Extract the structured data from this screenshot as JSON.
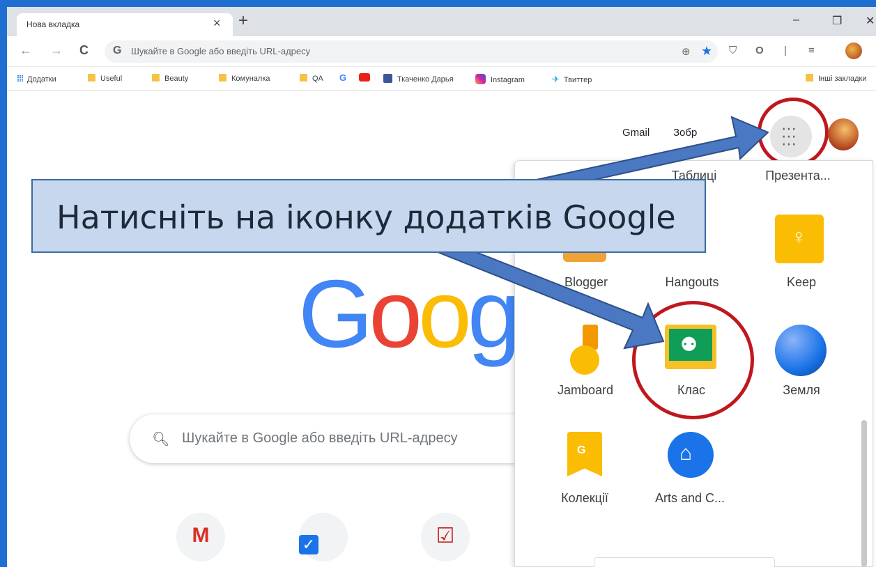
{
  "browser": {
    "tab_title": "Нова вкладка",
    "tab_close": "×",
    "new_tab": "+",
    "window_minimize": "–",
    "window_restore": "❐",
    "window_close": "✕",
    "omnibox_g": "G",
    "omnibox_placeholder": "Шукайте в Google або введіть URL-адресу",
    "back": "←",
    "forward": "→",
    "reload": "C"
  },
  "bookmarks": {
    "apps": "Додатки",
    "items": [
      "Useful",
      "Beauty",
      "Комуналка",
      "QA",
      "G",
      "Ткаченко Дарья",
      "Instagram",
      "Твиттер"
    ],
    "other": "Інші закладки"
  },
  "page": {
    "gmail": "Gmail",
    "images": "Зобр",
    "search_placeholder": "Шукайте в Google або введіть URL-адресу",
    "logo": [
      "G",
      "o",
      "o",
      "g"
    ],
    "logo_colors": [
      "#4285f4",
      "#ea4335",
      "#fbbc05",
      "#4285f4"
    ]
  },
  "launcher": {
    "top_labels": [
      "Таблиці",
      "Презента..."
    ],
    "apps": [
      "Blogger",
      "Hangouts",
      "Keep",
      "Jamboard",
      "Клас",
      "Земля",
      "Колекції",
      "Arts and C..."
    ]
  },
  "callout": {
    "text": "Натисніть на іконку додатків Google"
  },
  "colors": {
    "frame": "#1f6fd1",
    "highlight": "#c0171e",
    "arrow": "#4a78c2"
  }
}
